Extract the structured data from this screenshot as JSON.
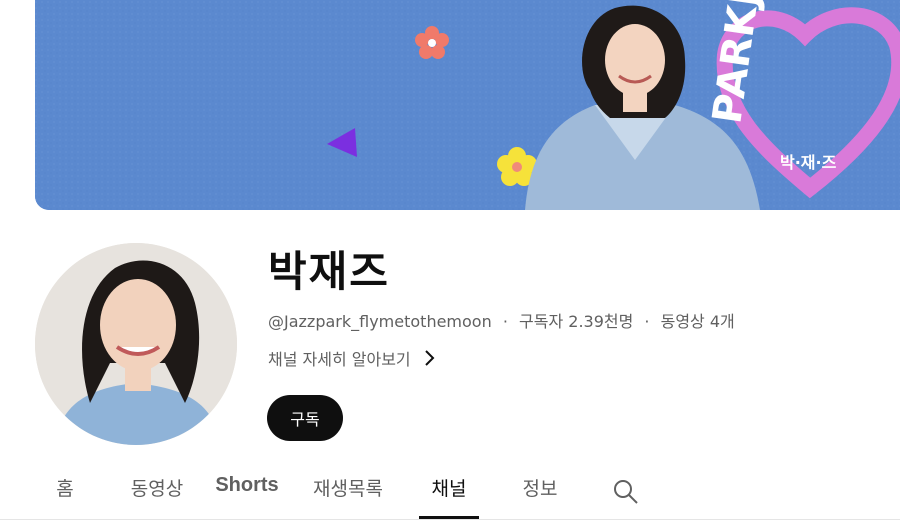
{
  "banner": {
    "logo_text": "PARKJAZZ",
    "logo_korean": "박·재·즈"
  },
  "channel": {
    "name": "박재즈",
    "handle": "@Jazzpark_flymetothemoon",
    "separator": "·",
    "subscribers": "구독자 2.39천명",
    "videos": "동영상 4개",
    "about_label": "채널 자세히 알아보기",
    "subscribe_label": "구독"
  },
  "tabs": [
    {
      "label": "홈",
      "active": false
    },
    {
      "label": "동영상",
      "active": false
    },
    {
      "label": "Shorts",
      "active": false
    },
    {
      "label": "재생목록",
      "active": false
    },
    {
      "label": "채널",
      "active": true
    },
    {
      "label": "정보",
      "active": false
    }
  ],
  "colors": {
    "banner_blue": "#5b89cf",
    "heart_pink": "#d97ad9",
    "text_primary": "#0f0f0f",
    "text_secondary": "#606060"
  }
}
